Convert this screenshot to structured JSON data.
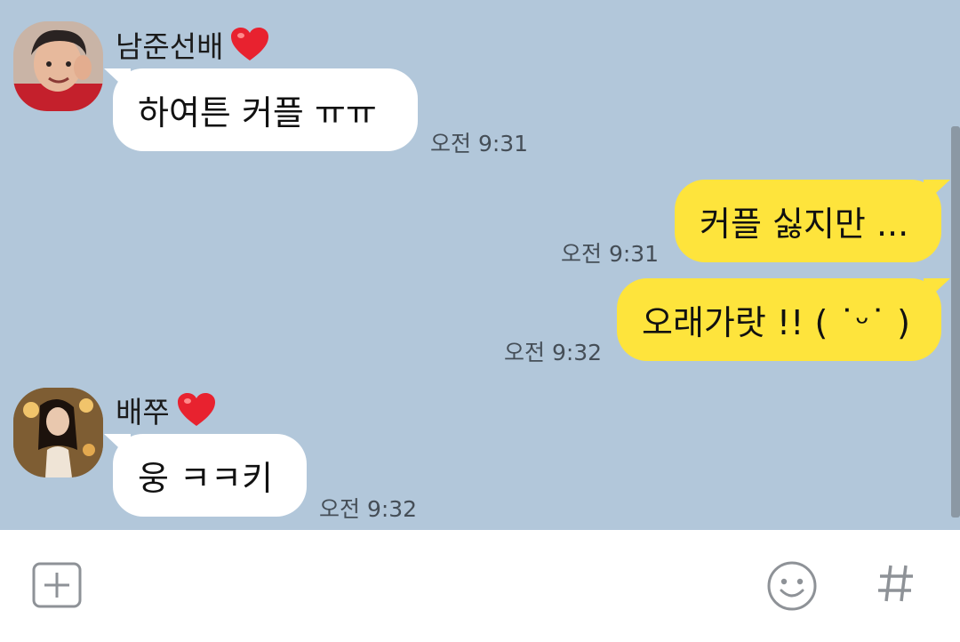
{
  "chat": {
    "messages": [
      {
        "sender": "남준선배",
        "text": "하여튼 커플 ㅠㅠ",
        "time": "오전 9:31",
        "direction": "in"
      },
      {
        "text": "커플 싫지만 ...",
        "time": "오전 9:31",
        "direction": "out"
      },
      {
        "text": "오래가랏 !! ( ˙ᵕ˙ )",
        "time": "오전 9:32",
        "direction": "out"
      },
      {
        "sender": "배쭈",
        "text": "웅 ㅋㅋ키",
        "time": "오전 9:32",
        "direction": "in"
      }
    ]
  },
  "input": {
    "value": "",
    "placeholder": ""
  },
  "icons": {
    "add": "plus-square-icon",
    "emoji": "smiley-icon",
    "hashtag": "hash-icon",
    "heart": "red-heart-icon"
  },
  "colors": {
    "background": "#b2c7da",
    "incoming_bubble": "#ffffff",
    "outgoing_bubble": "#fee43c",
    "heart": "#e8222f"
  }
}
